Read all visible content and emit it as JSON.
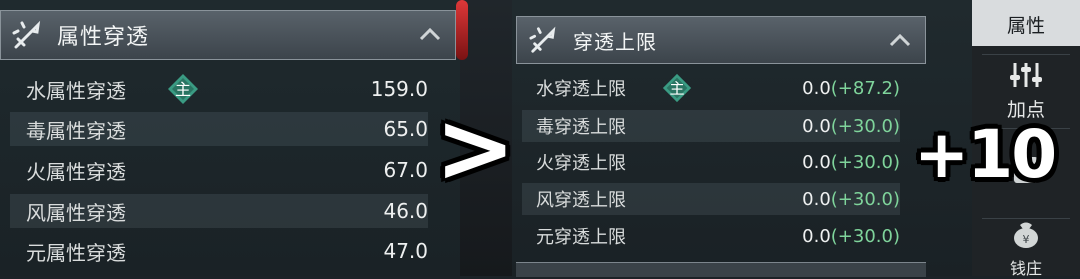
{
  "left_panel": {
    "title": "属性穿透",
    "icon": "crossed-swords-icon",
    "rows": [
      {
        "label": "水属性穿透",
        "value": "159.0",
        "tag": "主"
      },
      {
        "label": "毒属性穿透",
        "value": "65.0"
      },
      {
        "label": "火属性穿透",
        "value": "67.0"
      },
      {
        "label": "风属性穿透",
        "value": "46.0"
      },
      {
        "label": "元属性穿透",
        "value": "47.0"
      }
    ]
  },
  "right_panel": {
    "title": "穿透上限",
    "icon": "crossed-swords-icon",
    "rows": [
      {
        "label": "水穿透上限",
        "base": "0.0",
        "bonus": "(+87.2)",
        "tag": "主"
      },
      {
        "label": "毒穿透上限",
        "base": "0.0",
        "bonus": "(+30.0)"
      },
      {
        "label": "火穿透上限",
        "base": "0.0",
        "bonus": "(+30.0)"
      },
      {
        "label": "风穿透上限",
        "base": "0.0",
        "bonus": "(+30.0)"
      },
      {
        "label": "元穿透上限",
        "base": "0.0",
        "bonus": "(+30.0)"
      }
    ]
  },
  "overlay": {
    "comparison": ">",
    "plus_label": "+10"
  },
  "sidebar": {
    "tabs": [
      {
        "label": "属性",
        "icon": "attribute-icon",
        "active": true
      },
      {
        "label": "加点",
        "icon": "sliders-icon"
      },
      {
        "label": "",
        "icon": "scroll-icon"
      },
      {
        "label": "钱庄",
        "icon": "money-bag-icon"
      }
    ]
  },
  "colors": {
    "bonus": "#7fd49b",
    "tag": "#3a9b83"
  }
}
